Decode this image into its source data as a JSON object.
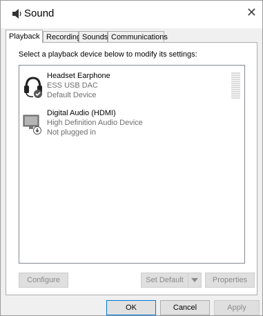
{
  "window": {
    "title": "Sound",
    "close_glyph": "✕"
  },
  "tabs": [
    {
      "label": "Playback",
      "active": true
    },
    {
      "label": "Recording",
      "active": false
    },
    {
      "label": "Sounds",
      "active": false
    },
    {
      "label": "Communications",
      "active": false
    }
  ],
  "playback": {
    "instruction": "Select a playback device below to modify its settings:",
    "devices": [
      {
        "name": "Headset Earphone",
        "description": "ESS USB DAC",
        "status": "Default Device",
        "icon": "headset-icon",
        "badge": "check-badge-icon"
      },
      {
        "name": "Digital Audio (HDMI)",
        "description": "High Definition Audio Device",
        "status": "Not plugged in",
        "icon": "monitor-icon",
        "badge": "unplugged-badge-icon"
      }
    ],
    "buttons": {
      "configure": "Configure",
      "set_default": "Set Default",
      "properties": "Properties"
    }
  },
  "footer": {
    "ok": "OK",
    "cancel": "Cancel",
    "apply": "Apply"
  },
  "colors": {
    "accent": "#0078d7",
    "disabled_text": "#8a8a8a"
  }
}
